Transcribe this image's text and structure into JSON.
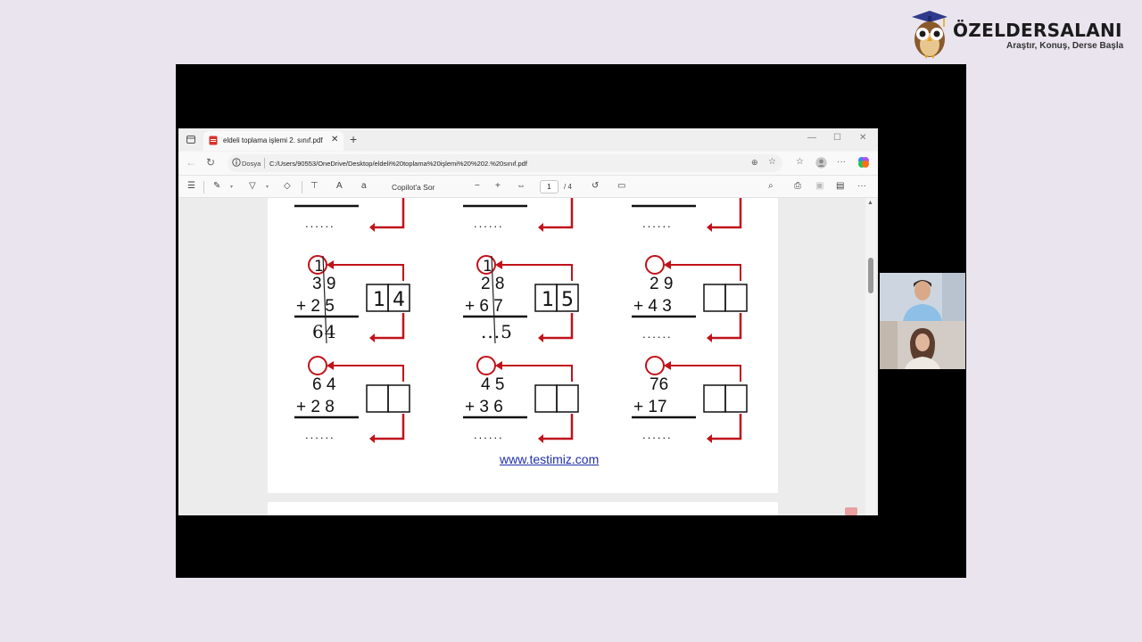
{
  "brand": {
    "name": "ÖZELDERSALANI",
    "slogan": "Araştır, Konuş, Derse Başla"
  },
  "browser": {
    "tab_title": "eldeli toplama işlemi 2. sınıf.pdf",
    "url_scheme": "Dosya",
    "url_path": "C:/Users/90553/OneDrive/Desktop/eldeli%20toplama%20işlemi%20%202.%20sınıf.pdf"
  },
  "toolbar": {
    "copilot_label": "Copilot'a Sor",
    "page_current": "1",
    "page_total": "/ 4"
  },
  "worksheet": {
    "top_rows": [
      {
        "dots": "......"
      },
      {
        "dots": "......"
      },
      {
        "dots": "......"
      }
    ],
    "problems": [
      {
        "a": "3 9",
        "b": "+ 2 5",
        "result": "64",
        "carry": "1",
        "boxes": [
          "1",
          "4"
        ]
      },
      {
        "a": "2 8",
        "b": "+ 6 7",
        "result": "...5",
        "carry": "1",
        "boxes": [
          "1",
          "5"
        ]
      },
      {
        "a": "2 9",
        "b": "+ 4 3",
        "result": "......",
        "carry": "",
        "boxes": [
          "",
          ""
        ]
      },
      {
        "a": "6 4",
        "b": "+ 2 8",
        "result": "......",
        "carry": "",
        "boxes": [
          "",
          ""
        ]
      },
      {
        "a": "4 5",
        "b": "+ 3 6",
        "result": "......",
        "carry": "",
        "boxes": [
          "",
          ""
        ]
      },
      {
        "a": "76",
        "b": "+ 17",
        "result": "......",
        "carry": "",
        "boxes": [
          "",
          ""
        ]
      }
    ],
    "website": "www.testimiz.com"
  },
  "colors": {
    "arrow": "#c0121a",
    "link": "#1f2fa8",
    "stage": "#000000",
    "background": "#e9e4ee"
  }
}
